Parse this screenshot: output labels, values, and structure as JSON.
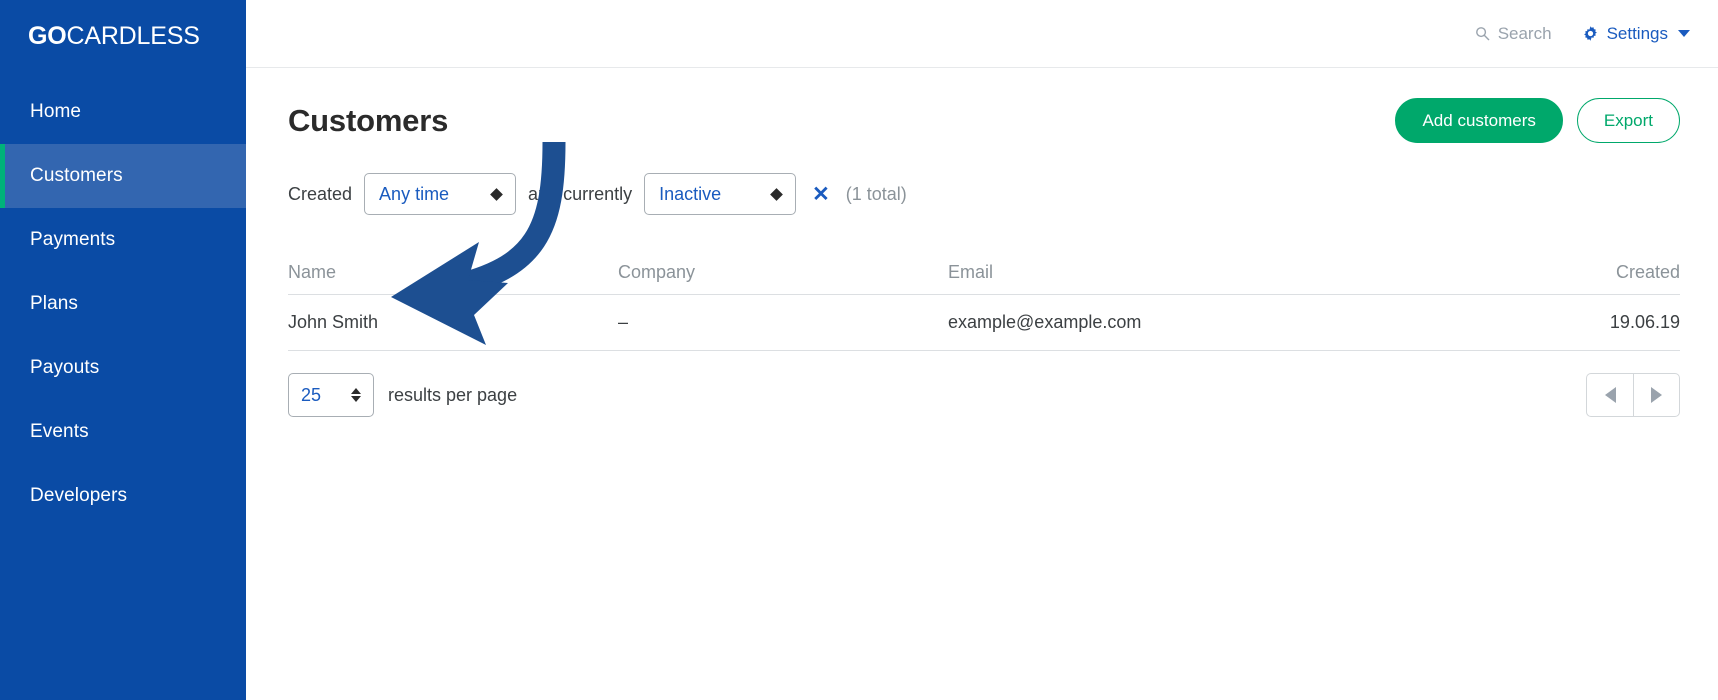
{
  "sidebar": {
    "brand": {
      "bold": "GO",
      "light": "CARDLESS"
    },
    "items": [
      {
        "label": "Home",
        "active": false
      },
      {
        "label": "Customers",
        "active": true
      },
      {
        "label": "Payments",
        "active": false
      },
      {
        "label": "Plans",
        "active": false
      },
      {
        "label": "Payouts",
        "active": false
      },
      {
        "label": "Events",
        "active": false
      },
      {
        "label": "Developers",
        "active": false
      }
    ],
    "colors": {
      "background": "#0a4ba5",
      "active_bg": "#3366b0",
      "active_accent": "#00b27a"
    }
  },
  "topbar": {
    "search_label": "Search",
    "settings_label": "Settings"
  },
  "page": {
    "title": "Customers",
    "add_button": "Add customers",
    "export_button": "Export"
  },
  "filters": {
    "created_label": "Created",
    "time_select": {
      "value": "Any time"
    },
    "conjunction_label": "and currently",
    "status_select": {
      "value": "Inactive"
    },
    "clear_icon": "✕",
    "total_label": "(1 total)"
  },
  "table": {
    "columns": [
      "Name",
      "Company",
      "Email",
      "Created"
    ],
    "rows": [
      {
        "name": "John Smith",
        "company": "–",
        "email": "example@example.com",
        "created": "19.06.19"
      }
    ]
  },
  "pagination": {
    "per_page_value": "25",
    "per_page_label": "results per page",
    "prev_icon": "triangle-left",
    "next_icon": "triangle-right"
  },
  "annotation": {
    "arrow_color": "#1d4f91",
    "description": "curved-arrow-pointing-to-customer-row"
  }
}
